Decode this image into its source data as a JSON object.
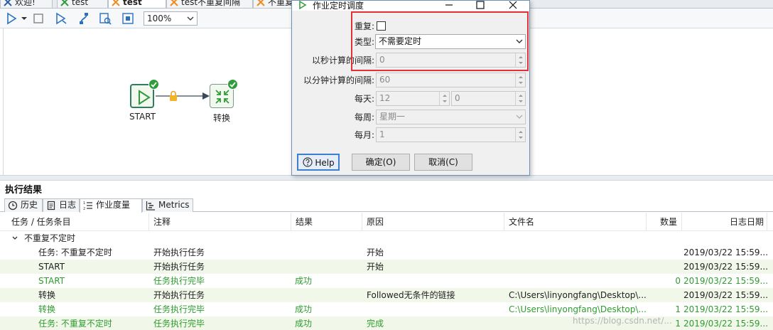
{
  "tabs": [
    {
      "label": "欢迎!",
      "active": false
    },
    {
      "label": "test",
      "active": false
    },
    {
      "label": "test",
      "active": true
    },
    {
      "label": "test不重复间隔",
      "active": false
    },
    {
      "label": "不重复",
      "active": false
    }
  ],
  "toolbar": {
    "zoom_value": "100%"
  },
  "canvas": {
    "start_label": "START",
    "transform_label": "转换"
  },
  "results": {
    "title": "执行结果",
    "tabs": [
      {
        "label": "历史"
      },
      {
        "label": "日志"
      },
      {
        "label": "作业度量"
      },
      {
        "label": "Metrics"
      }
    ],
    "columns": [
      "任务 / 任务条目",
      "注释",
      "结果",
      "原因",
      "文件名",
      "数量",
      "日志日期"
    ],
    "group_label": "不重复不定时",
    "rows": [
      {
        "task": "任务: 不重复不定时",
        "comment": "开始执行任务",
        "result": "",
        "reason": "开始",
        "file": "",
        "count": "",
        "date": "2019/03/22 15:59...",
        "status": "normal"
      },
      {
        "task": "START",
        "comment": "开始执行任务",
        "result": "",
        "reason": "开始",
        "file": "",
        "count": "",
        "date": "2019/03/22 15:59...",
        "status": "normal"
      },
      {
        "task": "START",
        "comment": "任务执行完毕",
        "result": "成功",
        "reason": "",
        "file": "",
        "count": "0",
        "date": "2019/03/22 15:59...",
        "status": "success"
      },
      {
        "task": "转换",
        "comment": "开始执行任务",
        "result": "",
        "reason": "Followed无条件的链接",
        "file": "C:\\Users\\linyongfang\\Desktop\\...",
        "count": "",
        "date": "2019/03/22 15:59...",
        "status": "normal"
      },
      {
        "task": "转换",
        "comment": "任务执行完毕",
        "result": "成功",
        "reason": "",
        "file": "C:\\Users\\linyongfang\\Desktop\\...",
        "count": "1",
        "date": "2019/03/22 15:59...",
        "status": "success"
      },
      {
        "task": "任务: 不重复不定时",
        "comment": "任务执行完毕",
        "result": "成功",
        "reason": "完成",
        "file": "",
        "count": "1",
        "date": "2019/03/22 15:59...",
        "status": "success"
      }
    ]
  },
  "dialog": {
    "title": "作业定时调度",
    "repeat_label": "重复:",
    "type_label": "类型:",
    "type_value": "不需要定时",
    "seconds_label": "以秒计算的间隔:",
    "seconds_value": "0",
    "minutes_label": "以分钟计算的间隔:",
    "minutes_value": "60",
    "daily_label": "每天:",
    "daily_hour": "12",
    "daily_minute": "0",
    "weekly_label": "每周:",
    "weekly_value": "星期一",
    "monthly_label": "每月:",
    "monthly_value": "1",
    "help_button": "Help",
    "ok_button": "确定(O)",
    "cancel_button": "取消(C)"
  },
  "watermark": "https://blog.csdn.net/...",
  "colors": {
    "success": "#2e9c2e",
    "highlight": "#e3313a",
    "accent": "#3c7fd0",
    "check": "#2e9c3a"
  }
}
